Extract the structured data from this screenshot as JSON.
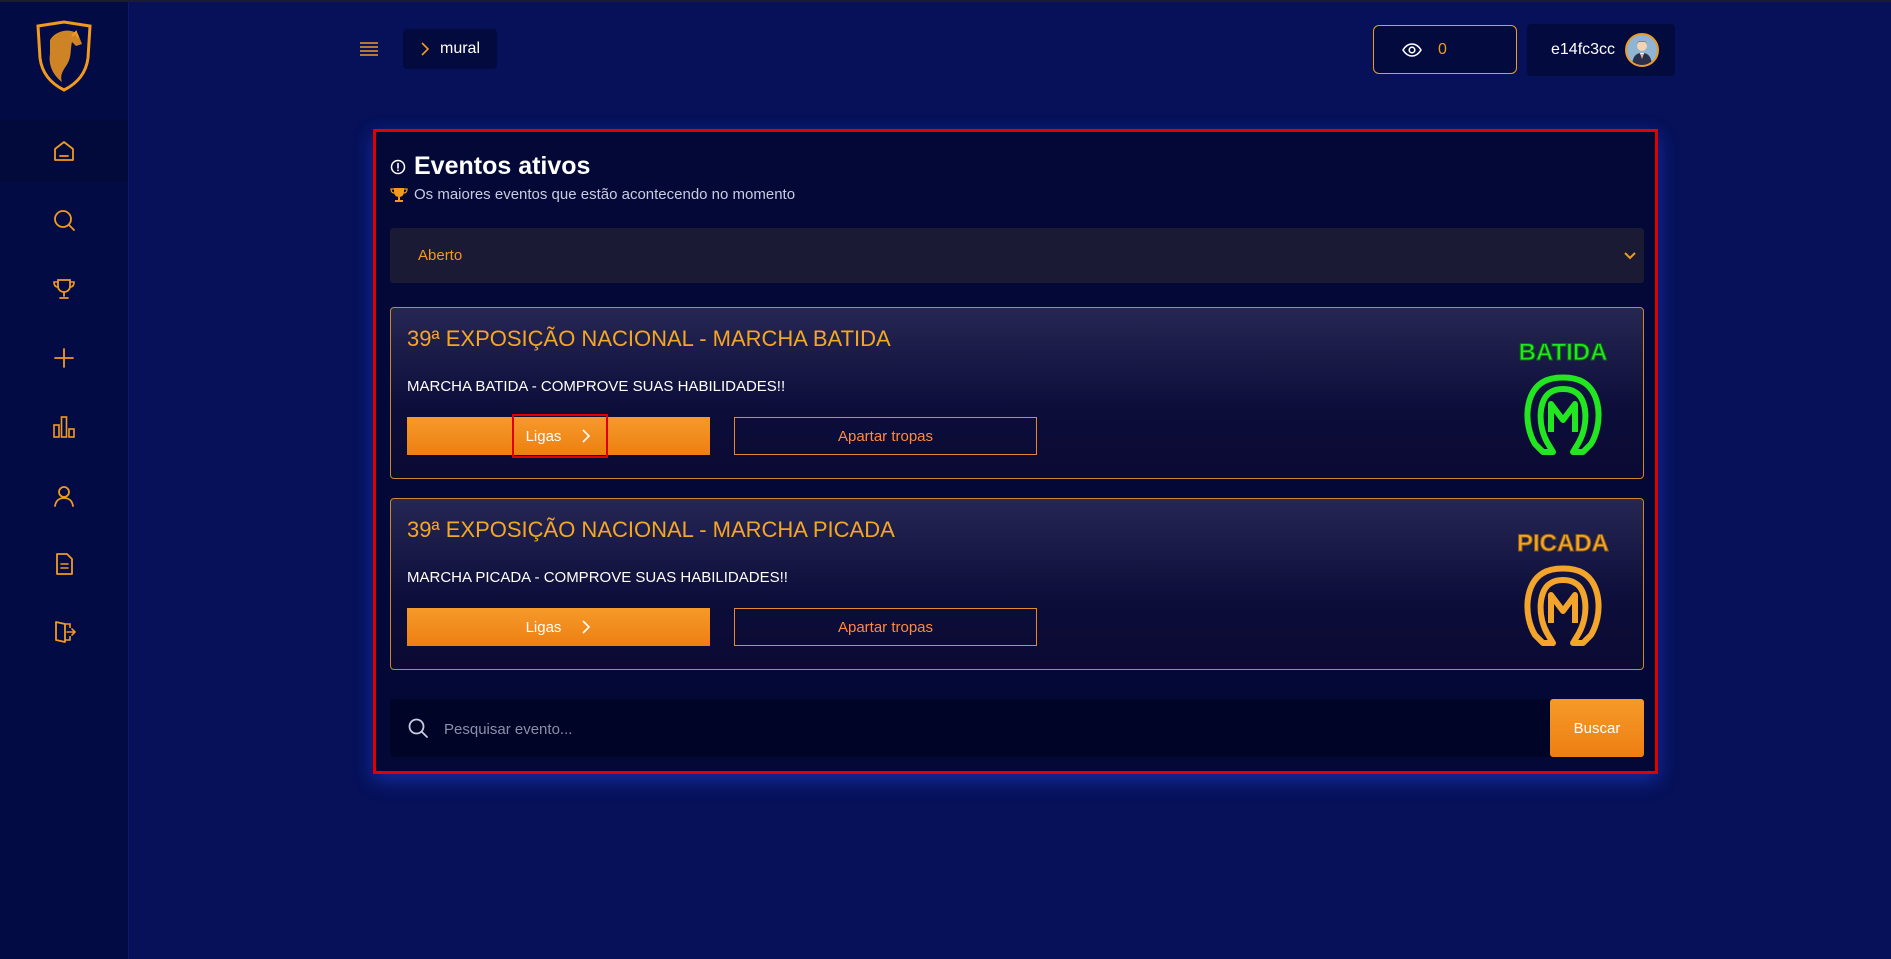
{
  "header": {
    "breadcrumb": "mural",
    "viewer_count": "0",
    "username": "e14fc3cc"
  },
  "sidebar": {
    "items": [
      {
        "icon": "home-icon"
      },
      {
        "icon": "search-icon"
      },
      {
        "icon": "trophy-icon"
      },
      {
        "icon": "plus-icon"
      },
      {
        "icon": "chart-icon"
      },
      {
        "icon": "user-icon"
      },
      {
        "icon": "document-icon"
      },
      {
        "icon": "logout-icon"
      }
    ]
  },
  "main": {
    "title": "Eventos ativos",
    "subtitle": "Os maiores eventos que estão acontecendo no momento",
    "filter": {
      "selected": "Aberto"
    },
    "events": [
      {
        "title": "39ª EXPOSIÇÃO NACIONAL - MARCHA BATIDA",
        "description": "MARCHA BATIDA - COMPROVE SUAS HABILIDADES!!",
        "ligas_label": "Ligas",
        "tropas_label": "Apartar tropas",
        "badge_text": "BATIDA",
        "badge_color": "#22e61f"
      },
      {
        "title": "39ª EXPOSIÇÃO NACIONAL - MARCHA PICADA",
        "description": "MARCHA PICADA - COMPROVE SUAS HABILIDADES!!",
        "ligas_label": "Ligas",
        "tropas_label": "Apartar tropas",
        "badge_text": "PICADA",
        "badge_color": "#f2a52a"
      }
    ],
    "search": {
      "placeholder": "Pesquisar evento...",
      "button_label": "Buscar"
    }
  },
  "colors": {
    "accent": "#f29a1e",
    "background": "#061159",
    "highlight": "#e00000"
  }
}
